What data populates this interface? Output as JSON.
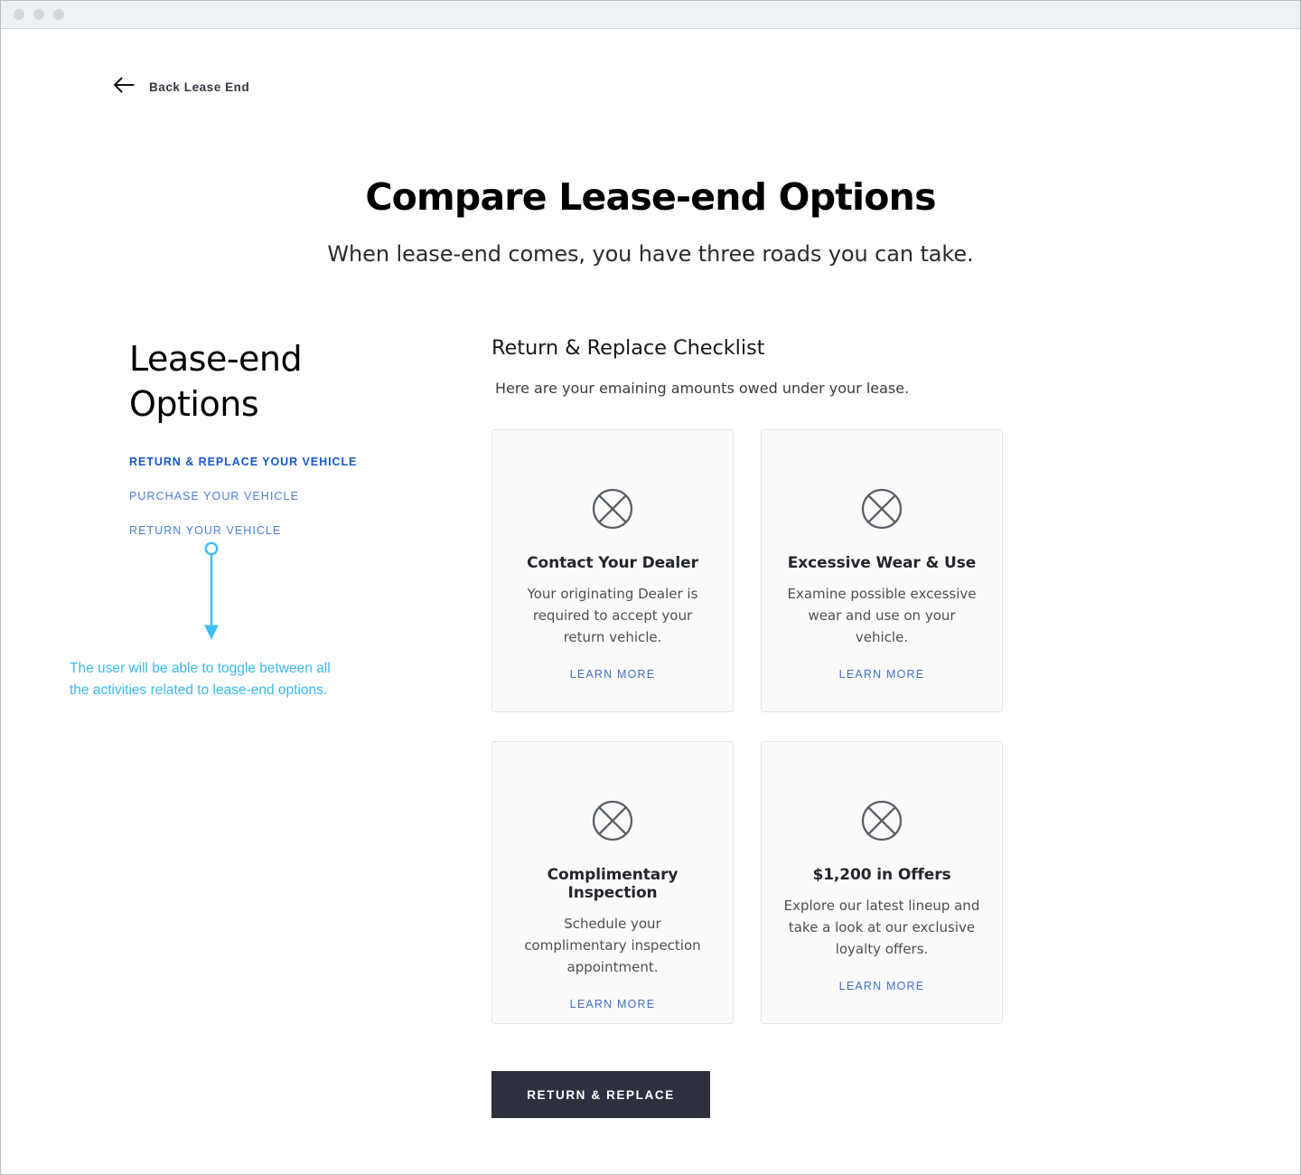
{
  "titlebar": {
    "dots": [
      "window-close-dot",
      "window-minimize-dot",
      "window-maximize-dot"
    ]
  },
  "back": {
    "label": "Back Lease End",
    "icon": "arrow-left-icon"
  },
  "header": {
    "title": "Compare Lease-end Options",
    "subtitle": "When lease-end comes, you have three roads you can take."
  },
  "sidebar": {
    "title": "Lease-end Options",
    "items": [
      {
        "label": "RETURN & REPLACE YOUR VEHICLE",
        "active": true
      },
      {
        "label": "PURCHASE YOUR VEHICLE",
        "active": false
      },
      {
        "label": "RETURN YOUR VEHICLE",
        "active": false
      }
    ]
  },
  "annotation": {
    "text": "The user will be able to toggle between all the activities related to lease-end options.",
    "color": "#39b7f2",
    "icon": "annotation-arrow-down-icon"
  },
  "content": {
    "title": "Return & Replace Checklist",
    "subtitle": "Here are your emaining amounts owed under your lease.",
    "cards": [
      {
        "icon": "image-placeholder-icon",
        "title": "Contact Your Dealer",
        "description": "Your originating Dealer is required to accept your return vehicle.",
        "link": "LEARN MORE"
      },
      {
        "icon": "image-placeholder-icon",
        "title": "Excessive Wear & Use",
        "description": "Examine possible excessive wear and use on your vehicle.",
        "link": "LEARN MORE"
      },
      {
        "icon": "image-placeholder-icon",
        "title": "Complimentary Inspection",
        "description": "Schedule your complimentary inspection appointment.",
        "link": "LEARN MORE"
      },
      {
        "icon": "image-placeholder-icon",
        "title": "$1,200 in Offers",
        "description": "Explore our latest lineup and take a look at our exclusive loyalty offers.",
        "link": "LEARN MORE"
      }
    ],
    "cta_label": "RETURN & REPLACE"
  },
  "colors": {
    "accent_blue": "#1558c7",
    "link_blue": "#4a7fd6",
    "annotation_cyan": "#39b7f2",
    "cta_dark": "#2c313c",
    "card_bg": "#fafafa",
    "card_border": "#e2e2e2"
  }
}
